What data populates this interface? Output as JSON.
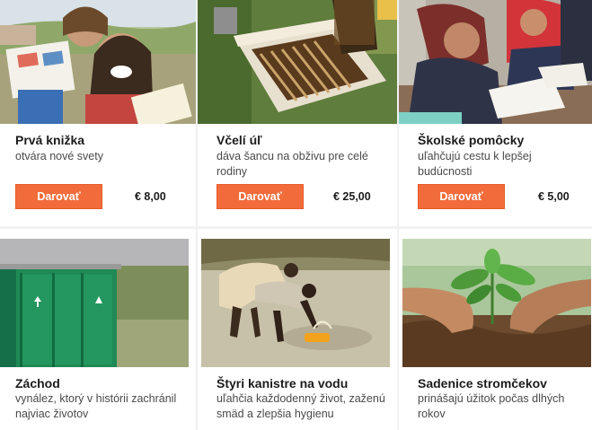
{
  "products": [
    {
      "title": "Prvá knižka",
      "desc": "otvára nové svety",
      "donate": "Darovať",
      "price": "€ 8,00",
      "image": "children-with-book-photo"
    },
    {
      "title": "Včelí úľ",
      "desc": "dáva šancu na obživu pre celé rodiny",
      "donate": "Darovať",
      "price": "€ 25,00",
      "image": "beehive-photo"
    },
    {
      "title": "Školské pomôcky",
      "desc": "uľahčujú cestu k lepšej budúcnosti",
      "donate": "Darovať",
      "price": "€ 5,00",
      "image": "girls-studying-photo"
    },
    {
      "title": "Záchod",
      "desc": "vynález, ktorý v histórii zachránil najviac životov",
      "image": "green-toilet-cabins-photo"
    },
    {
      "title": "Štyri kanistre na vodu",
      "desc": "uľahčia každodenný život, zaženú smäd a zlepšia hygienu",
      "image": "water-canister-photo"
    },
    {
      "title": "Sadenice stromčekov",
      "desc": "prinášajú úžitok počas dlhých rokov",
      "image": "tree-seedling-photo"
    }
  ]
}
